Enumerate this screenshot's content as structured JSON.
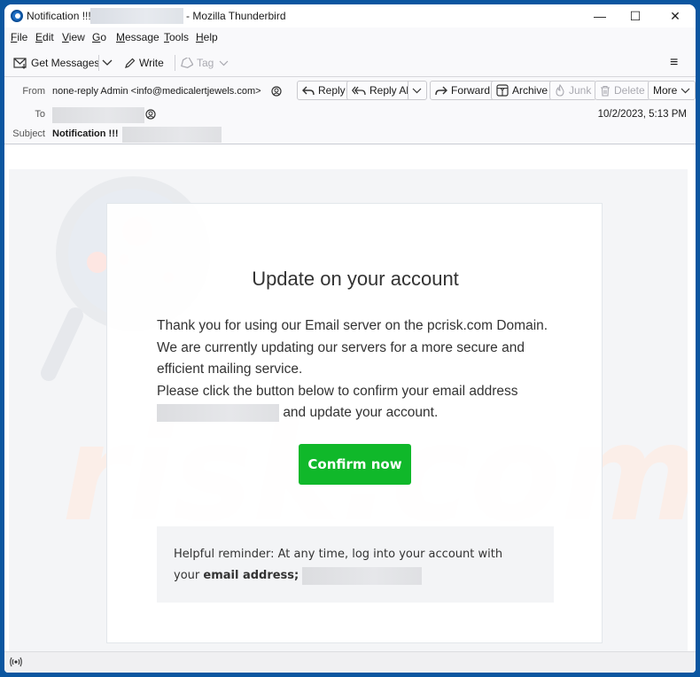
{
  "window": {
    "title_prefix": "Notification !!!",
    "title_app": "- Mozilla Thunderbird",
    "controls": {
      "minimize": "—",
      "maximize": "☐",
      "close": "✕"
    }
  },
  "menubar": {
    "items": [
      {
        "key": "F",
        "rest": "ile"
      },
      {
        "key": "E",
        "rest": "dit"
      },
      {
        "key": "V",
        "rest": "iew"
      },
      {
        "key": "G",
        "rest": "o"
      },
      {
        "key": "M",
        "rest": "essage"
      },
      {
        "key": "T",
        "rest": "ools"
      },
      {
        "key": "H",
        "rest": "elp"
      }
    ]
  },
  "toolbar": {
    "get_messages": "Get Messages",
    "write": "Write",
    "tag": "Tag",
    "menu_icon": "≡"
  },
  "header": {
    "from_label": "From",
    "from_value": "none-reply Admin <info@medicalertjewels.com>",
    "to_label": "To",
    "subject_label": "Subject",
    "subject_value": "Notification !!!",
    "date": "10/2/2023, 5:13 PM",
    "buttons": {
      "reply": "Reply",
      "reply_all": "Reply All",
      "forward": "Forward",
      "archive": "Archive",
      "junk": "Junk",
      "delete": "Delete",
      "more": "More"
    }
  },
  "email": {
    "title": "Update on your account",
    "lines": [
      "Thank you for using our Email server on the pcrisk.com Domain.",
      "We are currently updating our servers for a more secure and",
      "efficient mailing service.",
      "Please click the button below to confirm your email address"
    ],
    "line5_suffix": "and update your account.",
    "confirm_button": "Confirm now",
    "reminder_line1": "Helpful reminder: At any time, log into your account with",
    "reminder_line2_prefix": "your",
    "reminder_line2_bold": "email address;"
  },
  "colors": {
    "confirm_green": "#10b82a",
    "window_frame": "#0b56a0"
  }
}
